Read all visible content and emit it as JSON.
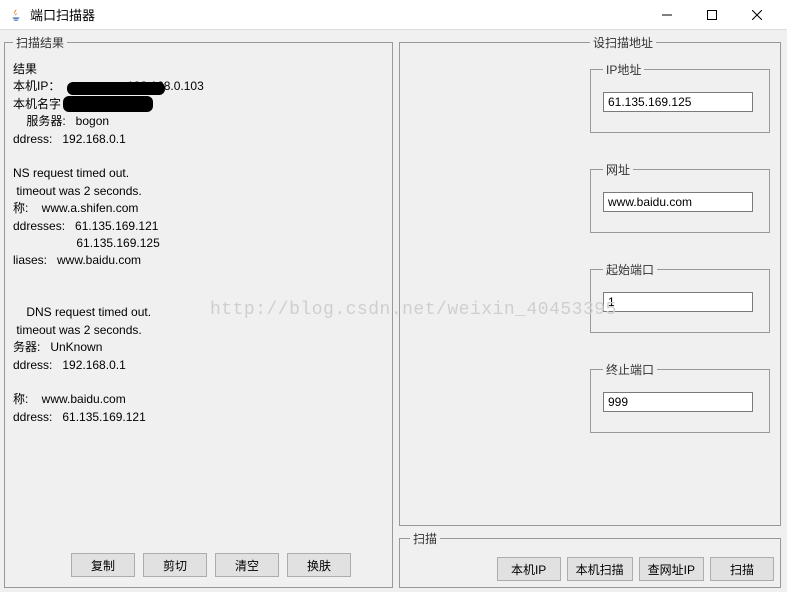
{
  "title": "端口扫描器",
  "watermark": "http://blog.csdn.net/weixin_40453395",
  "scan_result": {
    "legend": "扫描结果",
    "text": "结果\n本机IP：                    192.168.0.103\n本机名字\n    服务器:   bogon\nddress:   192.168.0.1\n\nNS request timed out.\n timeout was 2 seconds.\n称:    www.a.shifen.com\nddresses:   61.135.169.121\n                   61.135.169.125\nliases:   www.baidu.com\n\n\n    DNS request timed out.\n timeout was 2 seconds.\n务器:   UnKnown\nddress:   192.168.0.1\n\n称:    www.baidu.com\nddress:   61.135.169.121",
    "buttons": {
      "copy": "复制",
      "cut": "剪切",
      "clear": "清空",
      "skin": "换肤"
    }
  },
  "scan_addr": {
    "legend": "设扫描地址",
    "ip": {
      "legend": "IP地址",
      "value": "61.135.169.125"
    },
    "url": {
      "legend": "网址",
      "value": "www.baidu.com"
    },
    "start_port": {
      "legend": "起始端口",
      "value": "1"
    },
    "end_port": {
      "legend": "终止端口",
      "value": "999"
    }
  },
  "scan_action": {
    "legend": "扫描",
    "buttons": {
      "local_ip": "本机IP",
      "local_scan": "本机扫描",
      "lookup_ip": "查网址IP",
      "scan": "扫描"
    }
  }
}
